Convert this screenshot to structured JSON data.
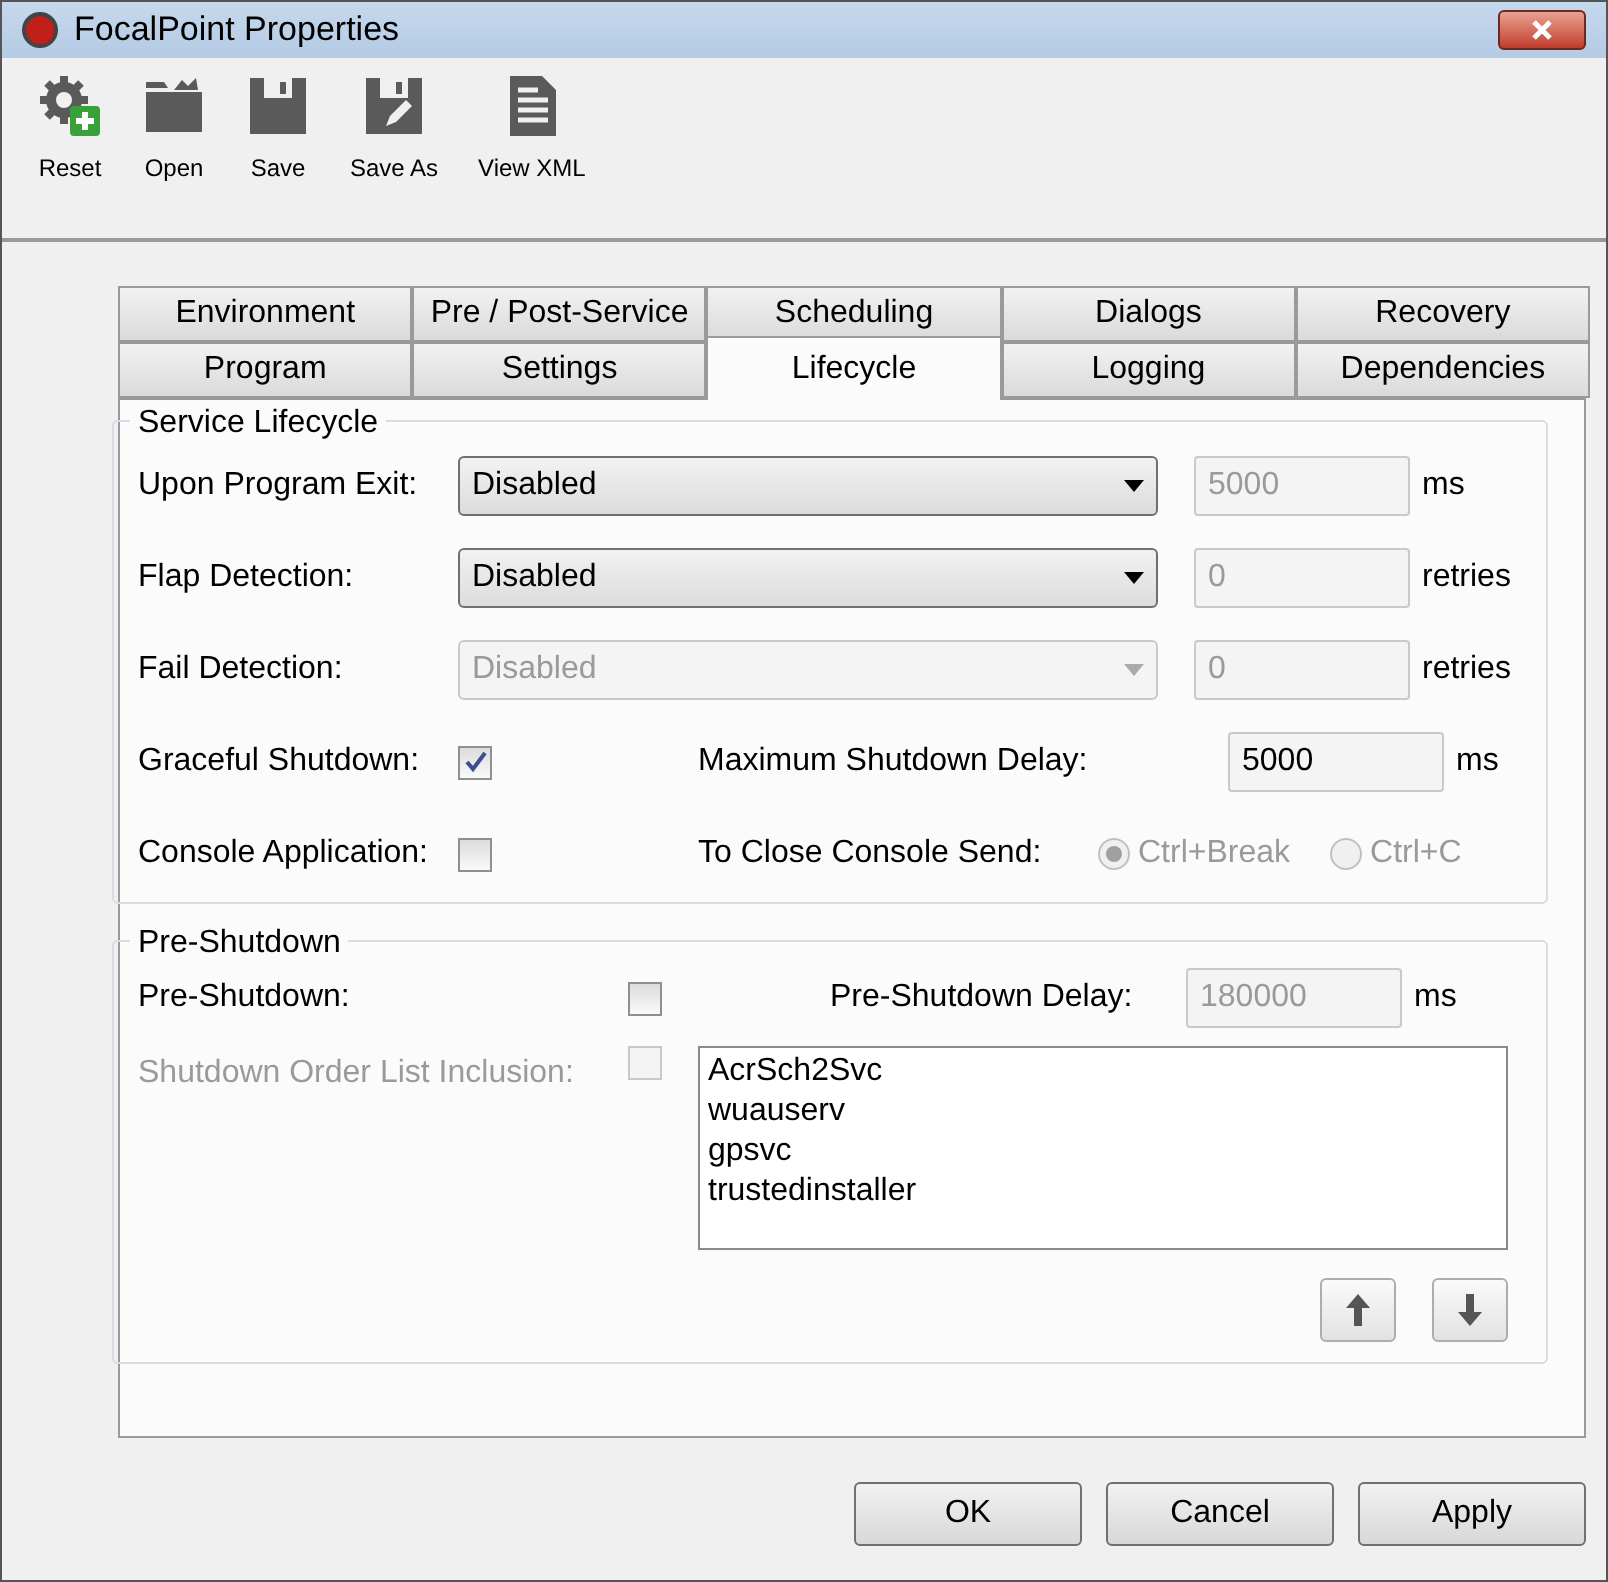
{
  "window": {
    "title": "FocalPoint Properties"
  },
  "toolbar": [
    {
      "kind": "reset",
      "label": "Reset"
    },
    {
      "kind": "open",
      "label": "Open"
    },
    {
      "kind": "save",
      "label": "Save"
    },
    {
      "kind": "save_as",
      "label": "Save As"
    },
    {
      "kind": "view_xml",
      "label": "View XML"
    }
  ],
  "tab_rows": [
    [
      {
        "label": "Environment",
        "selected": false
      },
      {
        "label": "Pre / Post-Service",
        "selected": false
      },
      {
        "label": "Scheduling",
        "selected": false
      },
      {
        "label": "Dialogs",
        "selected": false
      },
      {
        "label": "Recovery",
        "selected": false
      }
    ],
    [
      {
        "label": "Program",
        "selected": false
      },
      {
        "label": "Settings",
        "selected": false
      },
      {
        "label": "Lifecycle",
        "selected": true
      },
      {
        "label": "Logging",
        "selected": false
      },
      {
        "label": "Dependencies",
        "selected": false
      }
    ]
  ],
  "service_lifecycle": {
    "title": "Service Lifecycle",
    "dropdown_rows": [
      {
        "label": "Upon Program Exit:",
        "value": "Disabled",
        "disabled": false,
        "field_value": "5000",
        "field_disabled": true,
        "unit": "ms"
      },
      {
        "label": "Flap Detection:",
        "value": "Disabled",
        "disabled": false,
        "field_value": "0",
        "field_disabled": true,
        "unit": "retries"
      },
      {
        "label": "Fail Detection:",
        "value": "Disabled",
        "disabled": true,
        "field_value": "0",
        "field_disabled": true,
        "unit": "retries"
      }
    ],
    "graceful_shutdown": {
      "label": "Graceful Shutdown:",
      "checked": true
    },
    "max_delay": {
      "label": "Maximum Shutdown Delay:",
      "value": "5000",
      "disabled": false,
      "unit": "ms"
    },
    "console_application": {
      "label": "Console Application:",
      "checked": false
    },
    "close_console": {
      "label": "To Close Console Send:",
      "options": [
        {
          "label": "Ctrl+Break",
          "selected": true,
          "disabled": true
        },
        {
          "label": "Ctrl+C",
          "selected": false,
          "disabled": true
        }
      ]
    }
  },
  "pre_shutdown": {
    "title": "Pre-Shutdown",
    "pre_shutdown": {
      "label": "Pre-Shutdown:",
      "checked": false
    },
    "delay": {
      "label": "Pre-Shutdown Delay:",
      "value": "180000",
      "disabled": true,
      "unit": "ms"
    },
    "order_inclusion": {
      "label": "Shutdown Order List Inclusion:",
      "checked": false,
      "disabled": true
    },
    "order_list": [
      "AcrSch2Svc",
      "wuauserv",
      "gpsvc",
      "trustedinstaller"
    ]
  },
  "buttons": [
    "OK",
    "Cancel",
    "Apply"
  ]
}
